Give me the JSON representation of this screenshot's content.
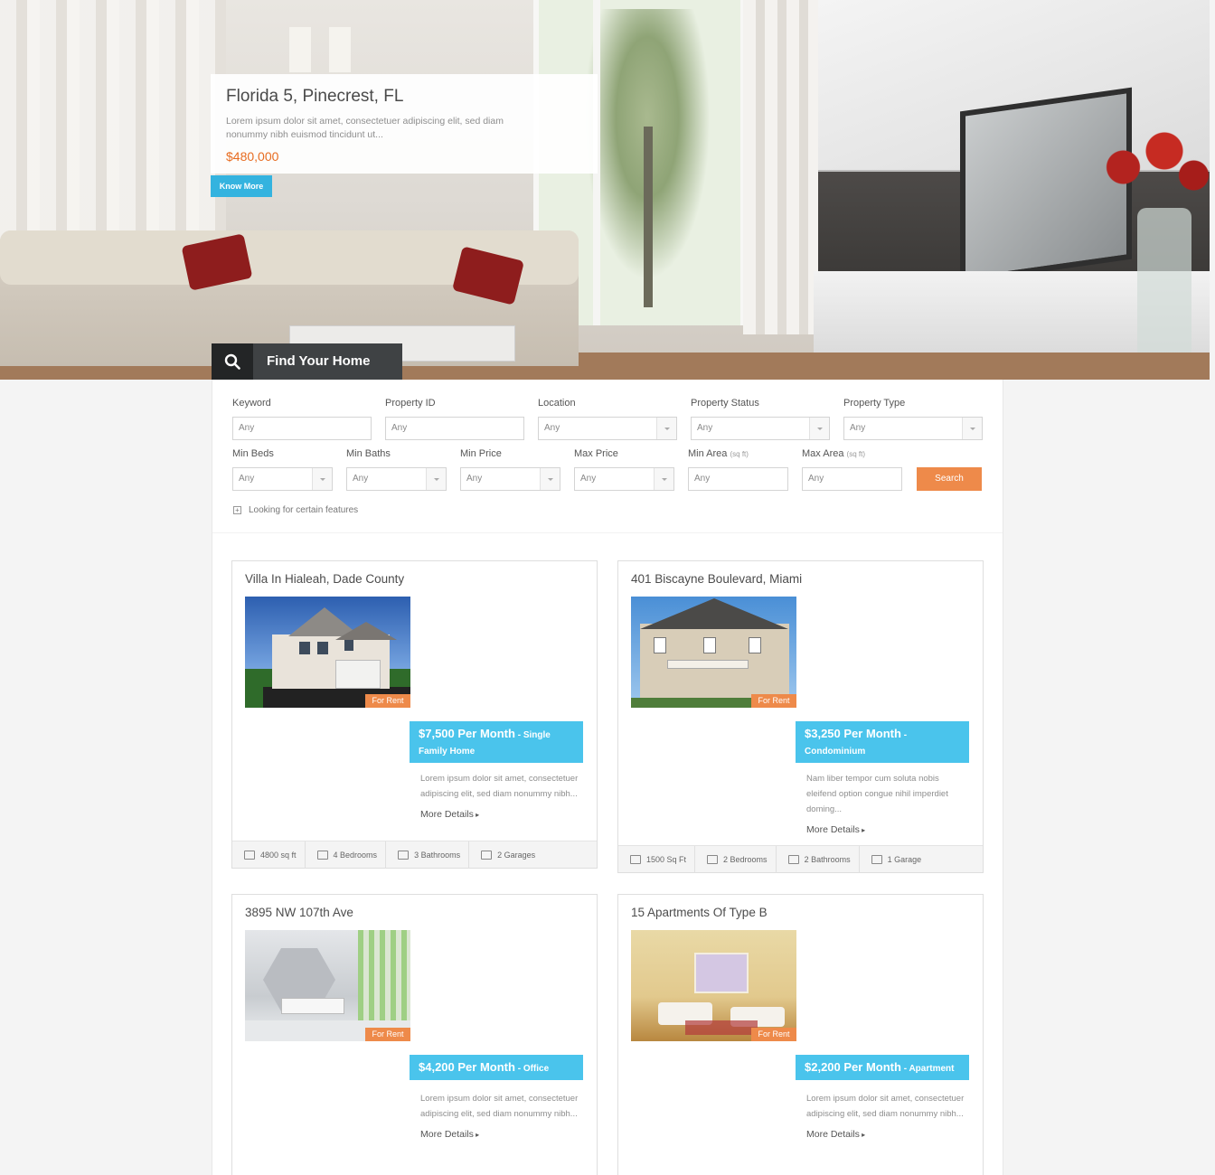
{
  "hero": {
    "title": "Florida 5, Pinecrest, FL",
    "description": "Lorem ipsum dolor sit amet, consectetuer adipiscing elit, sed diam nonummy nibh euismod tincidunt ut...",
    "price": "$480,000",
    "button_label": "Know More"
  },
  "find_bar": {
    "label": "Find Your Home",
    "icon": "search-icon"
  },
  "search": {
    "fields": [
      {
        "label": "Keyword",
        "value": "Any"
      },
      {
        "label": "Property ID",
        "value": "Any"
      },
      {
        "label": "Location",
        "value": "Any"
      },
      {
        "label": "Property Status",
        "value": "Any"
      },
      {
        "label": "Property Type",
        "value": "Any"
      },
      {
        "label": "Min Beds",
        "value": "Any"
      },
      {
        "label": "Min Baths",
        "value": "Any"
      },
      {
        "label": "Min Price",
        "value": "Any"
      },
      {
        "label": "Max Price",
        "value": "Any"
      },
      {
        "label": "Min Area",
        "unit": "(sq ft)",
        "value": "Any"
      },
      {
        "label": "Max Area",
        "unit": "(sq ft)",
        "value": "Any"
      }
    ],
    "button_label": "Search",
    "features_label": "Looking for certain features",
    "features_icon": "plus-square-icon"
  },
  "listings": [
    {
      "title": "Villa In Hialeah, Dade County",
      "badge": "For Rent",
      "price": "$7,500 Per Month",
      "type": " - Single Family Home",
      "description": "Lorem ipsum dolor sit amet, consectetuer adipiscing elit, sed diam nonummy nibh...",
      "more": "More Details",
      "stats": [
        "4800 sq ft",
        "4 Bedrooms",
        "3 Bathrooms",
        "2 Garages"
      ]
    },
    {
      "title": "401 Biscayne Boulevard, Miami",
      "badge": "For Rent",
      "price": "$3,250 Per Month",
      "type": " - Condominium",
      "description": "Nam liber tempor cum soluta nobis eleifend option congue nihil imperdiet doming...",
      "more": "More Details",
      "stats": [
        "1500 Sq Ft",
        "2 Bedrooms",
        "2 Bathrooms",
        "1 Garage"
      ]
    },
    {
      "title": "3895 NW 107th Ave",
      "badge": "For Rent",
      "price": "$4,200 Per Month",
      "type": " - Office",
      "description": "Lorem ipsum dolor sit amet, consectetuer adipiscing elit, sed diam nonummy nibh...",
      "more": "More Details"
    },
    {
      "title": "15 Apartments Of Type B",
      "badge": "For Rent",
      "price": "$2,200 Per Month",
      "type": " - Apartment",
      "description": "Lorem ipsum dolor sit amet, consectetuer adipiscing elit, sed diam nonummy nibh...",
      "more": "More Details"
    }
  ],
  "colors": {
    "accent": "#4ac4ec",
    "orange": "#ee8a4a",
    "price_orange": "#e76c21",
    "button_blue": "#34b3df"
  }
}
